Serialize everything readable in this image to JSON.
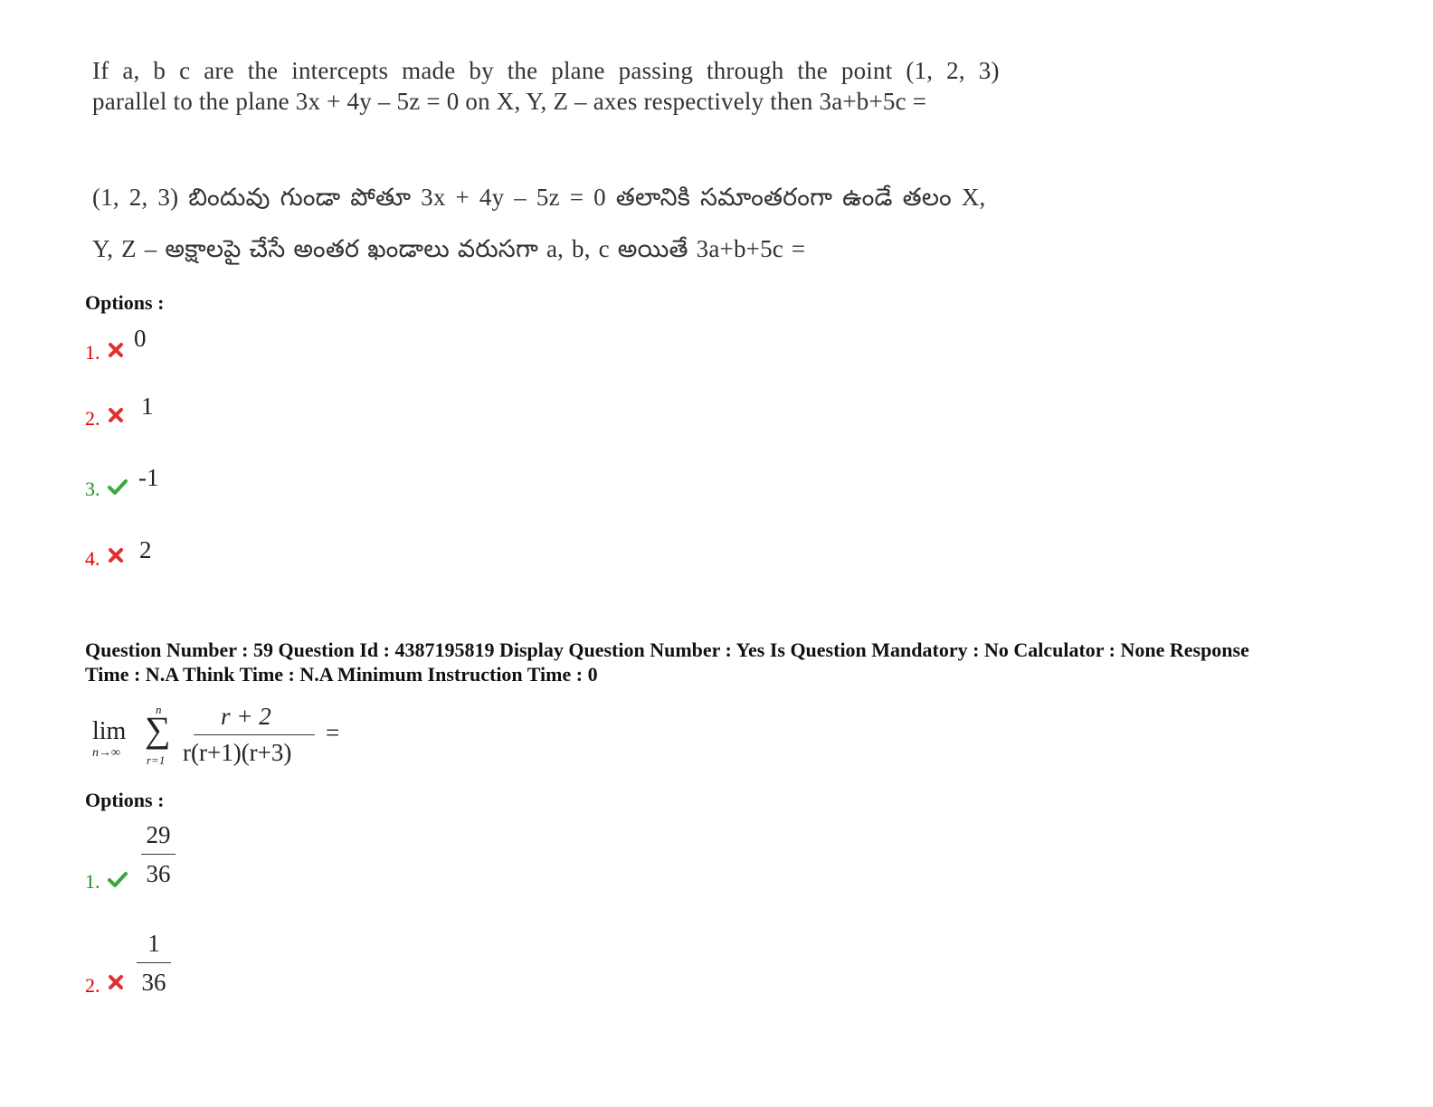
{
  "question58": {
    "english_line1": "If a, b c are the intercepts made by the plane passing through the point (1, 2, 3)",
    "english_line2": "parallel to the plane 3x + 4y – 5z = 0 on X, Y, Z – axes respectively then 3a+b+5c =",
    "telugu_line1": "(1, 2, 3) బిందువు గుండా పోతూ 3x + 4y – 5z = 0 తలానికి సమాంతరంగా ఉండే తలం X,",
    "telugu_line2": "Y, Z – అక్షాలపై చేసే అంతర ఖండాలు వరుసగా a, b, c అయితే 3a+b+5c =",
    "options_label": "Options :",
    "options": [
      {
        "number": "1.",
        "value": "0",
        "status": "wrong"
      },
      {
        "number": "2.",
        "value": "1",
        "status": "wrong"
      },
      {
        "number": "3.",
        "value": "-1",
        "status": "correct"
      },
      {
        "number": "4.",
        "value": "2",
        "status": "wrong"
      }
    ]
  },
  "question59": {
    "meta_line1": "Question Number : 59 Question Id : 4387195819 Display Question Number : Yes Is Question Mandatory : No Calculator : None Response",
    "meta_line2": "Time : N.A Think Time : N.A Minimum Instruction Time : 0",
    "formula": {
      "lim": "lim",
      "lim_sub": "n→∞",
      "sum_top": "n",
      "sum_sign": "∑",
      "sum_bottom": "r=1",
      "numerator": "r + 2",
      "denominator": "r(r+1)(r+3)",
      "equals": "="
    },
    "options_label": "Options :",
    "options": [
      {
        "number": "1.",
        "numerator": "29",
        "denominator": "36",
        "status": "correct"
      },
      {
        "number": "2.",
        "numerator": "1",
        "denominator": "36",
        "status": "wrong"
      }
    ]
  },
  "colors": {
    "wrong": "#e00000",
    "correct": "#1f8f1f"
  }
}
